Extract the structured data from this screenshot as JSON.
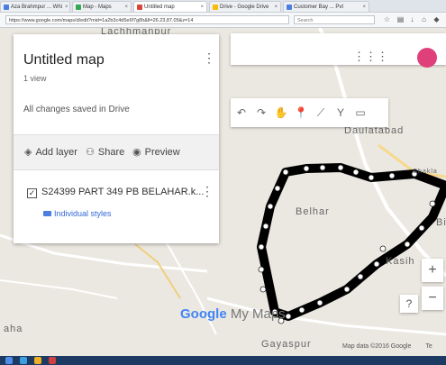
{
  "browser": {
    "tabs": [
      {
        "label": "Aza Brahmpur ... Whi",
        "color": "#4a7ee0"
      },
      {
        "label": "Map - Maps",
        "color": "#34a853"
      },
      {
        "label": "Untitled map",
        "color": "#db4437",
        "active": true
      },
      {
        "label": "Drive - Google Drive",
        "color": "#fbbc05"
      },
      {
        "label": "Customer Bay ... Pvt",
        "color": "#4a7ee0"
      }
    ],
    "url": "https://www.google.com/maps/d/edit?mid=1a2b3c4d5e6f7g8h&ll=26.23,87.05&z=14",
    "search_placeholder": "Search"
  },
  "map": {
    "places": {
      "top": "Lachhmanpur",
      "right": "Daulatabad",
      "belhar": "Belhar",
      "kasih": "Kasih",
      "left_bottom": "aha",
      "gayaspur": "Gayaspur",
      "edge_right": "Bi",
      "chakla": "Chakla"
    },
    "attribution": "Map data ©2016 Google",
    "attribution_cut": "Te",
    "logo_google": "Google",
    "logo_product": "My Maps"
  },
  "panel": {
    "title": "Untitled map",
    "views": "1 view",
    "status": "All changes saved in Drive",
    "add_layer": "Add layer",
    "share": "Share",
    "preview": "Preview",
    "layer_name": "S24399 PART 349 PB BELAHAR.k...",
    "individual_styles": "Individual styles"
  },
  "controls": {
    "zoom_in": "+",
    "zoom_out": "−",
    "help": "?"
  },
  "colors": {
    "polygon": "#000000",
    "accent": "#3367d6",
    "avatar": "#e0407a",
    "taskbar": "#1d3a63"
  }
}
